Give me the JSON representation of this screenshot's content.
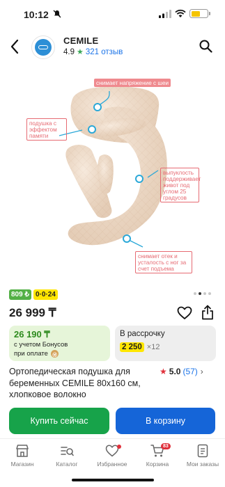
{
  "status_bar": {
    "time": "10:12"
  },
  "header": {
    "shop_name": "CEMILE",
    "rating": "4.9",
    "reviews": "321 отзыв"
  },
  "gallery": {
    "callouts": [
      "снимает напряжение с шеи",
      "подушка с эффектом памяти",
      "выпуклость поддерживает живот под углом 25 градусов",
      "снимает отек и усталость с ног за счет подъема"
    ],
    "pager_count": 4,
    "pager_active": 1
  },
  "badges": {
    "green": "809 ₺",
    "yellow": "0·0·24"
  },
  "price": "26 999 ₸",
  "bonus_box": {
    "price": "26 190 ₸",
    "line1": "с учетом Бонусов",
    "line2": "при оплате",
    "coin": "Ⓜ"
  },
  "installment_box": {
    "title": "В рассрочку",
    "amount": "2 250",
    "multiplier": "×12"
  },
  "product": {
    "title": "Ортопедическая подушка для беременных CEMILE 80х160 см, хлопковое волокно",
    "rating": "5.0",
    "reviews_count": "(57)"
  },
  "buttons": {
    "buy": "Купить сейчас",
    "cart": "В корзину"
  },
  "tabbar": {
    "items": [
      {
        "label": "Магазин",
        "icon": "shop-icon"
      },
      {
        "label": "Каталог",
        "icon": "catalog-icon"
      },
      {
        "label": "Избранное",
        "icon": "heart-icon"
      },
      {
        "label": "Корзина",
        "icon": "cart-icon",
        "badge": "83"
      },
      {
        "label": "Мои заказы",
        "icon": "orders-icon"
      }
    ]
  },
  "colors": {
    "green": "#17a34a",
    "blue": "#1565d8",
    "yellow": "#ffe600",
    "callout": "#ef8a8f",
    "pillow": "#f3dfcb"
  }
}
